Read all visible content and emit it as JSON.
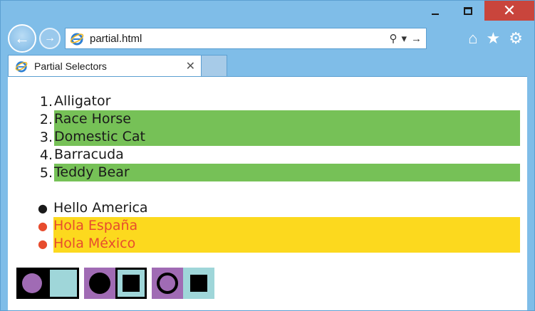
{
  "window": {
    "minimize_glyph": "minimize-icon",
    "maximize_glyph": "maximize-icon",
    "close_glyph": "✕"
  },
  "nav": {
    "back_glyph": "←",
    "forward_glyph": "→",
    "address": "partial.html",
    "search_glyph": "⚲",
    "dropdown_glyph": "▾",
    "go_glyph": "→"
  },
  "toolbar": {
    "home_glyph": "⌂",
    "favorites_glyph": "★",
    "settings_glyph": "⚙"
  },
  "tab": {
    "label": "Partial Selectors",
    "close_glyph": "✕"
  },
  "ordered_list": {
    "items": [
      {
        "num": "1.",
        "text": "Alligator",
        "highlight": false
      },
      {
        "num": "2.",
        "text": "Race Horse",
        "highlight": true
      },
      {
        "num": "3.",
        "text": "Domestic Cat",
        "highlight": true
      },
      {
        "num": "4.",
        "text": "Barracuda",
        "highlight": false
      },
      {
        "num": "5.",
        "text": "Teddy Bear",
        "highlight": true
      }
    ]
  },
  "unordered_list": {
    "items": [
      {
        "bullet": "●",
        "text": "Hello America",
        "highlight": false
      },
      {
        "bullet": "●",
        "text": "Hola España",
        "highlight": true
      },
      {
        "bullet": "●",
        "text": "Hola México",
        "highlight": true
      }
    ]
  },
  "colors": {
    "green": "#76c157",
    "yellow": "#fcd91e",
    "red_text": "#e74c2e",
    "purple": "#a06bb4",
    "teal": "#9fd6d9",
    "black": "#000000"
  }
}
